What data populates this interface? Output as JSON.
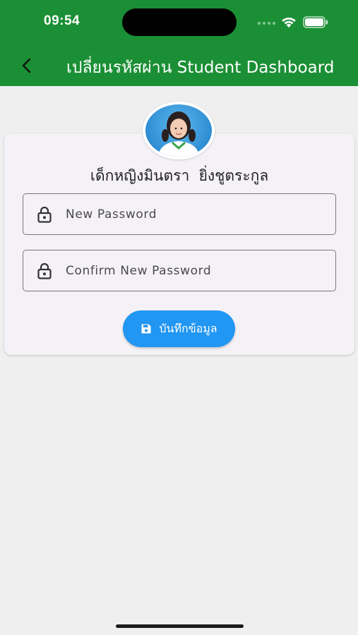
{
  "status_bar": {
    "time": "09:54"
  },
  "header": {
    "title": "เปลี่ยนรหัสผ่าน Student Dashboard",
    "back_icon": "chevron-left-icon",
    "background": "#1b8f35"
  },
  "profile": {
    "student_name": "เด็กหญิงมินตรา  ยิ่งชูตระกูล"
  },
  "form": {
    "new_password": {
      "placeholder": "New Password",
      "value": "",
      "icon": "lock-icon"
    },
    "confirm_password": {
      "placeholder": "Confirm New Password",
      "value": "",
      "icon": "lock-icon"
    },
    "save_button": {
      "label": "บันทึกข้อมูล",
      "icon": "save-icon",
      "color": "#2196f3"
    }
  }
}
